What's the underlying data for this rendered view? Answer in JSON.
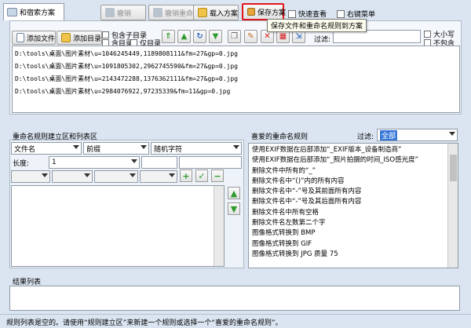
{
  "tab": {
    "label": "和宿索方案"
  },
  "toolbar": {
    "undo_label": "撤销",
    "undo_rename_label": "撤销重命名(U)",
    "load_scheme_label": "载入方案",
    "save_scheme_label": "保存方案",
    "quick_view_label": "快速查看",
    "context_menu_label": "右键菜单"
  },
  "tooltip": {
    "text": "保存文件和重命名规则到方案"
  },
  "file_toolbar": {
    "add_file_label": "添加文件",
    "add_dir_label": "添加目录",
    "include_subdir_label": "包含子目录",
    "include_dir_label": "含目录",
    "only_dir_label": "仅目录",
    "filter_label": "过滤:",
    "case_label": "大小写",
    "exclude_label": "不包含"
  },
  "files": [
    "D:\\tools\\桌面\\图片素材\\u=1046245449,1189808111&fm=27&gp=0.jpg",
    "D:\\tools\\桌面\\图片素材\\u=1091805302,2962745590&fm=27&gp=0.jpg",
    "D:\\tools\\桌面\\图片素材\\u=2143472288,1376362111&fm=27&gp=0.jpg",
    "D:\\tools\\桌面\\图片素材\\u=2984076922,97235339&fm=11&gp=0.jpg"
  ],
  "rule_builder": {
    "title": "重命名规则建立区和列表区",
    "field_value": "文件名",
    "position_value": "前缀",
    "type_value": "随机字符",
    "length_label": "长度:",
    "length_value": "1"
  },
  "favorites": {
    "title": "喜爱的重命名规则",
    "filter_label": "过滤:",
    "filter_value": "全部",
    "items": [
      "使用EXIF数据在后部添加“_EXIF版本_设备制造商”",
      "使用EXIF数据在后部添加“_照片拍摄的时间_ISO感光度”",
      "删除文件中所有的“_”",
      "删除文件名中“()”内的所有内容",
      "删除文件名中“-”号及其前面所有内容",
      "删除文件名中“-”号及其后面所有内容",
      "删除文件名中所有空格",
      "删除文件名左数第二个字",
      "图像格式转换到 BMP",
      "图像格式转换到 GIF",
      "图像格式转换到 JPG 质量 75"
    ]
  },
  "results": {
    "title": "结果列表"
  },
  "status": {
    "text": "规则列表是空的。请使用“规则建立区”来新建一个规则或选择一个“喜爱的重命名规则”。"
  },
  "colors": {
    "accent_red": "#e0161b",
    "panel_bg": "#dbe5f1",
    "selected_filter": "#3a78d8"
  }
}
